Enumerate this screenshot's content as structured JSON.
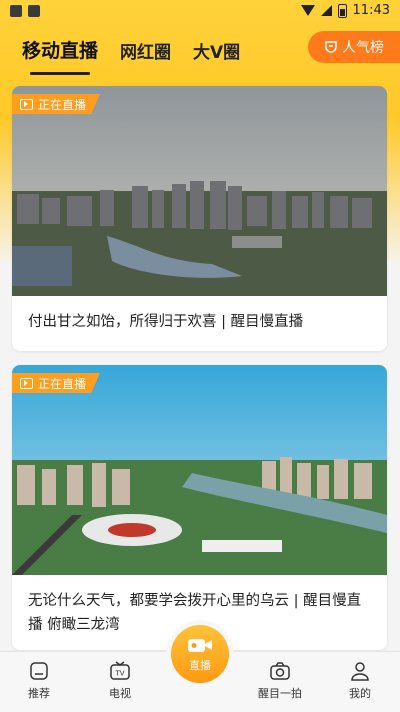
{
  "status_bar": {
    "time": "11:43"
  },
  "tabs": [
    {
      "label": "移动直播",
      "active": true
    },
    {
      "label": "网红圈",
      "active": false
    },
    {
      "label": "大V圈",
      "active": false
    }
  ],
  "rank_button": {
    "label": "人气榜"
  },
  "cards": [
    {
      "badge": "正在直播",
      "title": "付出甘之如饴，所得归于欢喜 | 醒目慢直播"
    },
    {
      "badge": "正在直播",
      "title": "无论什么天气，都要学会拨开心里的乌云 | 醒目慢直播 俯瞰三龙湾"
    }
  ],
  "bottom_nav": {
    "items": [
      {
        "label": "推荐",
        "icon": "home-icon"
      },
      {
        "label": "电视",
        "icon": "tv-icon"
      },
      {
        "label": "醒目一拍",
        "icon": "camera-icon"
      },
      {
        "label": "我的",
        "icon": "user-icon"
      }
    ],
    "center": {
      "label": "直播",
      "icon": "video-camera-icon"
    }
  },
  "colors": {
    "accent": "#ff7a1a",
    "header": "#ffd23a",
    "badge": "#ff9d1e"
  }
}
